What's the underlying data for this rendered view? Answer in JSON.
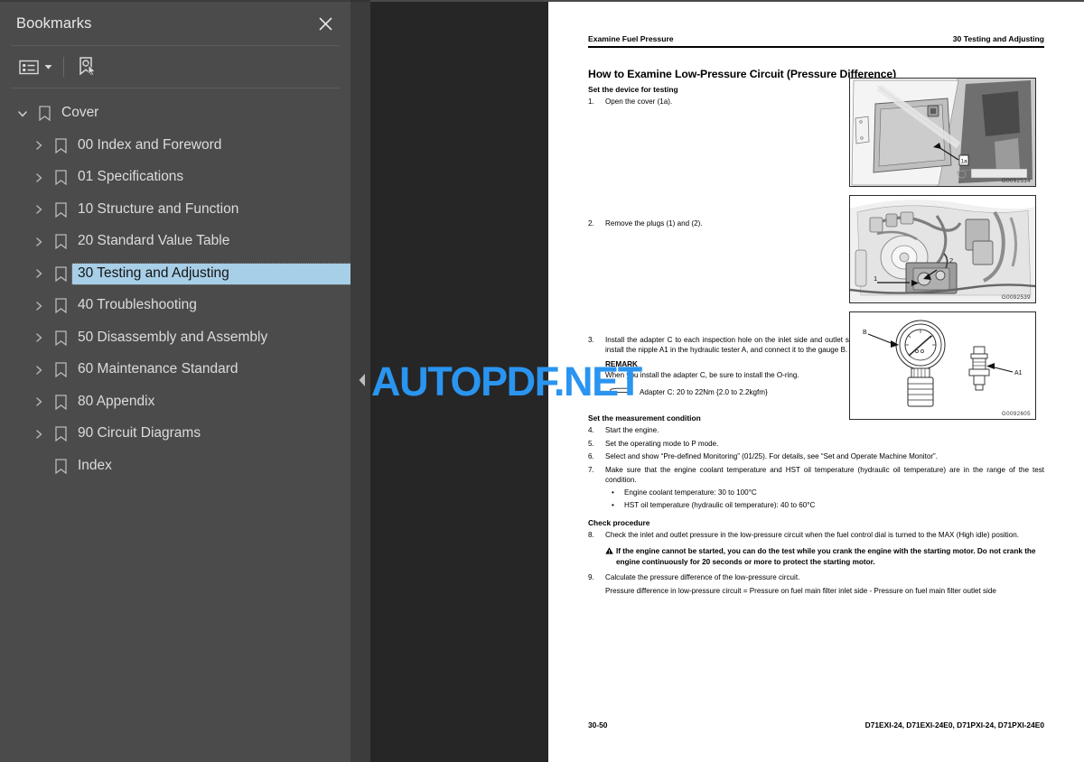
{
  "sidebar": {
    "title": "Bookmarks",
    "close_icon": "close-icon",
    "toolbar": {
      "list_options_label": "list-options-icon",
      "caret_label": "chevron-down-icon",
      "new_bookmark_label": "new-bookmark-icon"
    },
    "tree": [
      {
        "label": "Cover",
        "level": 0,
        "expanded": true,
        "has_children": true,
        "selected": false
      },
      {
        "label": "00 Index and Foreword",
        "level": 1,
        "expanded": false,
        "has_children": true,
        "selected": false
      },
      {
        "label": "01 Specifications",
        "level": 1,
        "expanded": false,
        "has_children": true,
        "selected": false
      },
      {
        "label": "10 Structure and Function",
        "level": 1,
        "expanded": false,
        "has_children": true,
        "selected": false
      },
      {
        "label": "20 Standard Value Table",
        "level": 1,
        "expanded": false,
        "has_children": true,
        "selected": false
      },
      {
        "label": "30 Testing and Adjusting",
        "level": 1,
        "expanded": false,
        "has_children": true,
        "selected": true
      },
      {
        "label": "40 Troubleshooting",
        "level": 1,
        "expanded": false,
        "has_children": true,
        "selected": false
      },
      {
        "label": "50 Disassembly and Assembly",
        "level": 1,
        "expanded": false,
        "has_children": true,
        "selected": false
      },
      {
        "label": "60 Maintenance Standard",
        "level": 1,
        "expanded": false,
        "has_children": true,
        "selected": false
      },
      {
        "label": "80 Appendix",
        "level": 1,
        "expanded": false,
        "has_children": true,
        "selected": false
      },
      {
        "label": "90 Circuit Diagrams",
        "level": 1,
        "expanded": false,
        "has_children": true,
        "selected": false
      },
      {
        "label": "Index",
        "level": 1,
        "expanded": false,
        "has_children": false,
        "selected": false
      }
    ]
  },
  "viewer": {
    "collapse_handle_icon": "chevron-left-icon",
    "watermark": "AUTOPDF.NET",
    "watermark_color": "#2a95f0"
  },
  "document": {
    "header_left": "Examine Fuel Pressure",
    "header_right": "30 Testing and Adjusting",
    "section_title": "How to Examine Low-Pressure Circuit (Pressure Difference)",
    "sub_set_device": "Set the device for testing",
    "step1_num": "1.",
    "step1_text": "Open the cover (1a).",
    "step2_num": "2.",
    "step2_text": "Remove the plugs (1) and (2).",
    "step3_num": "3.",
    "step3_text": "Install the adapter C to each inspection hole on the inlet side and outlet side, install the nipple A1 in the hydraulic tester A, and connect it to the gauge B.",
    "remark_label": "REMARK",
    "remark_text": "When you install the adapter C, be sure to install the O-ring.",
    "torque_text": "Adapter C: 20 to 22Nm {2.0 to 2.2kgfm}",
    "sub_measurement": "Set the measurement condition",
    "step4_num": "4.",
    "step4_text": "Start the engine.",
    "step5_num": "5.",
    "step5_text": "Set the operating mode to P mode.",
    "step6_num": "6.",
    "step6_text": "Select and show “Pre-defined Monitoring” (01/25). For details, see “Set and Operate Machine Monitor”.",
    "step7_num": "7.",
    "step7_text": "Make sure that the engine coolant temperature and HST oil temperature (hydraulic oil temperature) are in the range of the test condition.",
    "bullet1": "Engine coolant temperature: 30 to 100°C",
    "bullet2": "HST oil temperature (hydraulic oil temperature): 40 to 60°C",
    "sub_check": "Check procedure",
    "step8_num": "8.",
    "step8_text": "Check the inlet and outlet pressure in the low-pressure circuit when the fuel control dial is turned to the MAX (High idle) position.",
    "warning_text": "If the engine cannot be started, you can do the test while you crank the engine with the starting motor. Do not crank the engine continuously for 20 seconds or more to protect the starting motor.",
    "step9_num": "9.",
    "step9_text": "Calculate the pressure difference of the low-pressure circuit.",
    "equation": "Pressure difference in low-pressure circuit = Pressure on fuel main filter inlet side - Pressure on fuel main filter outlet side",
    "figure1_id": "G0092534",
    "figure2_id": "G0092539",
    "figure3_id": "G0092605",
    "figure1_callout": "1a",
    "figure2_callout_1": "1",
    "figure2_callout_2": "2",
    "figure3_callout_b": "B",
    "figure3_callout_a1": "A1",
    "footer_left": "30-50",
    "footer_right": "D71EXI-24, D71EXI-24E0, D71PXI-24, D71PXI-24E0"
  }
}
